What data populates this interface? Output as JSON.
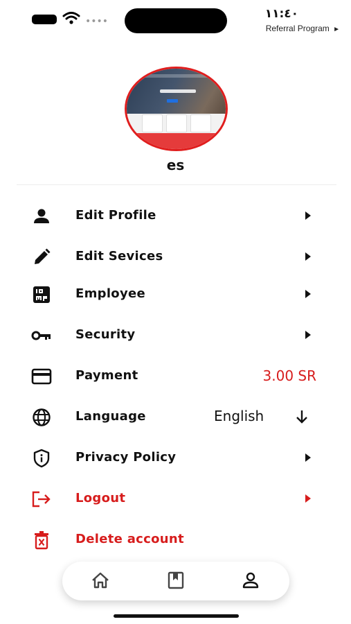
{
  "status_bar": {
    "time": "١١:٤٠",
    "back_app": "Referral Program",
    "back_glyph": "►",
    "signal_dots": "••••"
  },
  "profile": {
    "username": "es"
  },
  "menu": [
    {
      "id": "edit-profile",
      "label": "Edit Profile",
      "icon": "person-icon"
    },
    {
      "id": "edit-services",
      "label": "Edit Sevices",
      "icon": "pencil-icon"
    },
    {
      "id": "employee",
      "label": "Employee",
      "icon": "employee-badge-icon"
    },
    {
      "id": "security",
      "label": "Security",
      "icon": "key-icon"
    },
    {
      "id": "payment",
      "label": "Payment",
      "icon": "credit-card-icon",
      "value": "3.00 SR"
    },
    {
      "id": "language",
      "label": "Language",
      "icon": "globe-icon",
      "value": "English"
    },
    {
      "id": "privacy-policy",
      "label": "Privacy Policy",
      "icon": "shield-info-icon"
    },
    {
      "id": "logout",
      "label": "Logout",
      "icon": "logout-icon"
    },
    {
      "id": "delete-account",
      "label": "Delete account",
      "icon": "trash-icon"
    }
  ],
  "bottom_nav": [
    {
      "id": "home",
      "icon": "home-icon"
    },
    {
      "id": "bookmarks",
      "icon": "bookmark-icon"
    },
    {
      "id": "profile",
      "icon": "profile-icon",
      "active": true
    }
  ],
  "colors": {
    "accent_red": "#d71c1c",
    "text": "#111111",
    "background": "#ffffff"
  }
}
